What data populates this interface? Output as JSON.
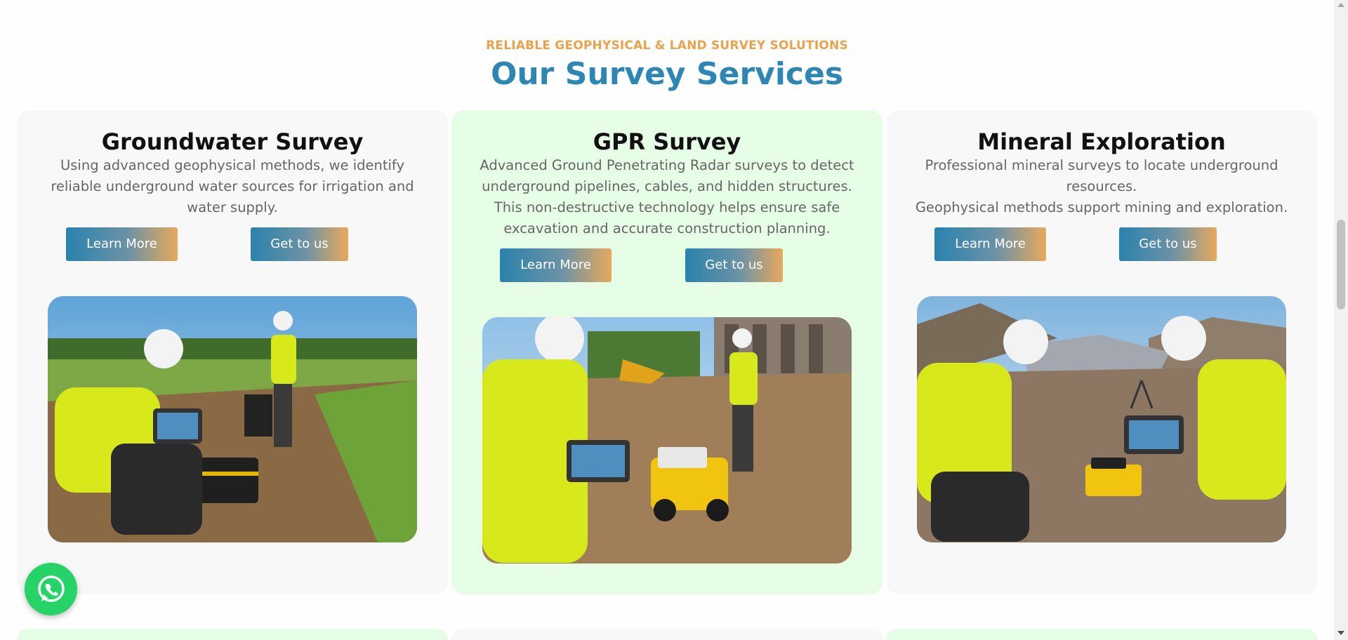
{
  "section": {
    "eyebrow": "RELIABLE GEOPHYSICAL & LAND SURVEY SOLUTIONS",
    "title": "Our Survey Services"
  },
  "cards": [
    {
      "title": "Groundwater Survey",
      "desc_lines": [
        "Using advanced geophysical methods, we identify",
        "reliable underground water sources for irrigation and",
        "water supply."
      ],
      "learn_more": "Learn More",
      "get_to_us": "Get to us",
      "photo": "groundwater-survey-field-photo"
    },
    {
      "title": "GPR Survey",
      "desc_lines": [
        "Advanced Ground Penetrating Radar surveys to detect",
        "underground pipelines, cables, and hidden structures.",
        "This non-destructive technology helps ensure safe",
        "excavation and accurate construction planning."
      ],
      "learn_more": "Learn More",
      "get_to_us": "Get to us",
      "photo": "gpr-survey-construction-photo"
    },
    {
      "title": "Mineral Exploration",
      "desc_lines": [
        "Professional mineral surveys to locate underground",
        "resources.",
        "Geophysical methods support mining and exploration."
      ],
      "learn_more": "Learn More",
      "get_to_us": "Get to us",
      "photo": "mineral-exploration-rocky-photo"
    }
  ],
  "colors": {
    "accent_orange": "#e8a24e",
    "accent_blue": "#2e86b4",
    "highlight_card": "#e6fde6",
    "card_bg": "#f8f8f8",
    "whatsapp_green": "#25d366"
  },
  "icons": {
    "floating_chat": "whatsapp-icon"
  }
}
